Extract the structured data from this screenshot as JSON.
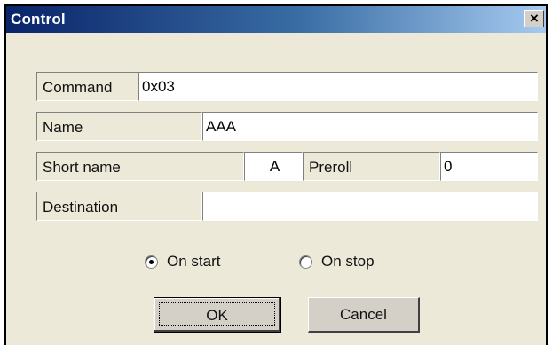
{
  "window": {
    "title": "Control",
    "close_glyph": "×",
    "close_icon": "close-icon"
  },
  "form": {
    "command": {
      "label": "Command",
      "value": "0x03"
    },
    "name": {
      "label": "Name",
      "value": "AAA"
    },
    "short_name": {
      "label": "Short name",
      "value": "A"
    },
    "preroll": {
      "label": "Preroll",
      "value": "0"
    },
    "destination": {
      "label": "Destination",
      "value": ""
    }
  },
  "trigger": {
    "options": [
      {
        "label": "On start",
        "selected": true
      },
      {
        "label": "On stop",
        "selected": false
      }
    ]
  },
  "buttons": {
    "ok": "OK",
    "cancel": "Cancel"
  },
  "colors": {
    "titlebar_start": "#0a246a",
    "titlebar_end": "#a6caf0",
    "dialog_bg": "#ece9d8"
  }
}
